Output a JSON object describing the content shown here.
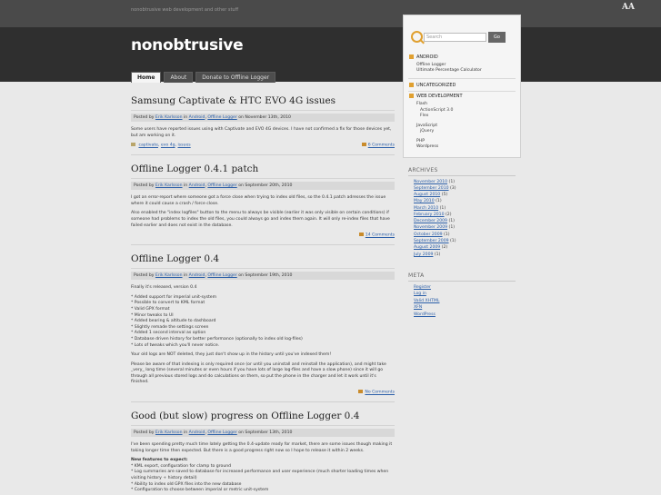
{
  "site": {
    "tagline": "nonobtrusive web development and other stuff",
    "title": "nonobtrusive",
    "font_toggle": "AA"
  },
  "nav": {
    "tabs": [
      {
        "label": "Home"
      },
      {
        "label": "About"
      },
      {
        "label": "Donate to Offline Logger"
      }
    ]
  },
  "posts": [
    {
      "title": "Samsung Captivate & HTC EVO 4G issues",
      "meta": {
        "pre": "Posted by",
        "author": "Erik Karlsson",
        "in": "in",
        "cat1": "Android",
        "comma": ",",
        "cat2": "Offline Logger",
        "on": "on November 13th, 2010"
      },
      "body": [
        "Some users have reported issues using with Captivate and EVO 4G devices. I have not confirmed a fix for those devices yet, but am working on it."
      ],
      "tags": {
        "t1": "captivate",
        "t2": "evo 4g",
        "t3": "issues"
      },
      "comments": "6 Comments"
    },
    {
      "title": "Offline Logger 0.4.1 patch",
      "meta": {
        "pre": "Posted by",
        "author": "Erik Karlsson",
        "in": "in",
        "cat1": "Android",
        "comma": ",",
        "cat2": "Offline Logger",
        "on": "on September 20th, 2010"
      },
      "body": [
        "I got an error-report where someone got a force close when trying to index old files, so the 0.4.1 patch adresses the issue where it could cause a crash / force close.",
        "Also enabled the \"index logfiles\" button to the menu to always be visible (earlier it was only visible on certain conditions) if someone had problems to index the old files, you could always go and index them again. It will only re-index files that have failed earlier and does not exist in the database."
      ],
      "comments": "14 Comments"
    },
    {
      "title": "Offline Logger 0.4",
      "meta": {
        "pre": "Posted by",
        "author": "Erik Karlsson",
        "in": "in",
        "cat1": "Android",
        "comma": ",",
        "cat2": "Offline Logger",
        "on": "on September 19th, 2010"
      },
      "body": [
        "Finally it's released, version 0.4"
      ],
      "list": [
        "* Added support for imperial unit-system",
        "* Possible to convert to KML format",
        "* Valid GPX format",
        "* Minor tweaks to UI",
        "* Added bearing & altitude to dashboard",
        "* Slightly remade the settings screen",
        "* Added 1 second interval as option",
        "* Database driven history for better performance (optionally to index old log-files)",
        "* Lots of tweaks which you'll never notice."
      ],
      "body2": [
        "Your old logs are NOT deleted, they just don't show up in the history until you've indexed them!",
        "Please be aware of that indexing is only required once (or until you uninstall and reinstall the application), and might take _very_ long time (several minutes or even hours if you have lots of large log-files and have a slow phone) since it will go through all previous stored logs and do calculations on them, so put the phone in the charger and let it work until it's finished."
      ],
      "comments": "No Comments"
    },
    {
      "title": "Good (but slow) progress on Offline Logger 0.4",
      "meta": {
        "pre": "Posted by",
        "author": "Erik Karlsson",
        "in": "in",
        "cat1": "Android",
        "comma": ",",
        "cat2": "Offline Logger",
        "on": "on September 13th, 2010"
      },
      "body": [
        "I've been spending pretty much time lately getting the 0.4-update ready for market, there are some issues though making it taking longer time then expected. But there is a good progress right now so I hope to release it within 2 weeks."
      ],
      "features_heading": "New features to expect:",
      "list": [
        "* KML export, configuration for clamp to ground",
        "* Log summaries are saved to database for increased performance and user experience (much shorter loading times when visiting history + history detail)",
        "* Ability to index old GPX files into the new database",
        "* Configuration to choose between imperial or metric unit-system"
      ]
    }
  ],
  "sidebar": {
    "search_placeholder": "Search",
    "search_button": "Go",
    "categories": [
      {
        "label": "ANDROID",
        "children": [
          "Offline Logger",
          "Ultimate Percentage Calculator"
        ]
      },
      {
        "label": "UNCATEGORIZED",
        "children": []
      },
      {
        "label": "WEB DEVELOPMENT",
        "children": [
          "Flash",
          "ActionScript 3.0",
          "Flex",
          "JavaScript",
          "jQuery",
          "PHP",
          "Wordpress"
        ]
      }
    ],
    "archives_title": "ARCHIVES",
    "archives": [
      {
        "label": "November 2010",
        "count": "(1)"
      },
      {
        "label": "September 2010",
        "count": "(3)"
      },
      {
        "label": "August 2010",
        "count": "(5)"
      },
      {
        "label": "May 2010",
        "count": "(1)"
      },
      {
        "label": "March 2010",
        "count": "(1)"
      },
      {
        "label": "February 2010",
        "count": "(2)"
      },
      {
        "label": "December 2009",
        "count": "(1)"
      },
      {
        "label": "November 2009",
        "count": "(1)"
      },
      {
        "label": "October 2009",
        "count": "(1)"
      },
      {
        "label": "September 2009",
        "count": "(1)"
      },
      {
        "label": "August 2009",
        "count": "(2)"
      },
      {
        "label": "July 2009",
        "count": "(1)"
      }
    ],
    "meta_title": "META",
    "meta_links": [
      "Register",
      "Log in",
      "Valid XHTML",
      "XFN",
      "WordPress"
    ]
  }
}
